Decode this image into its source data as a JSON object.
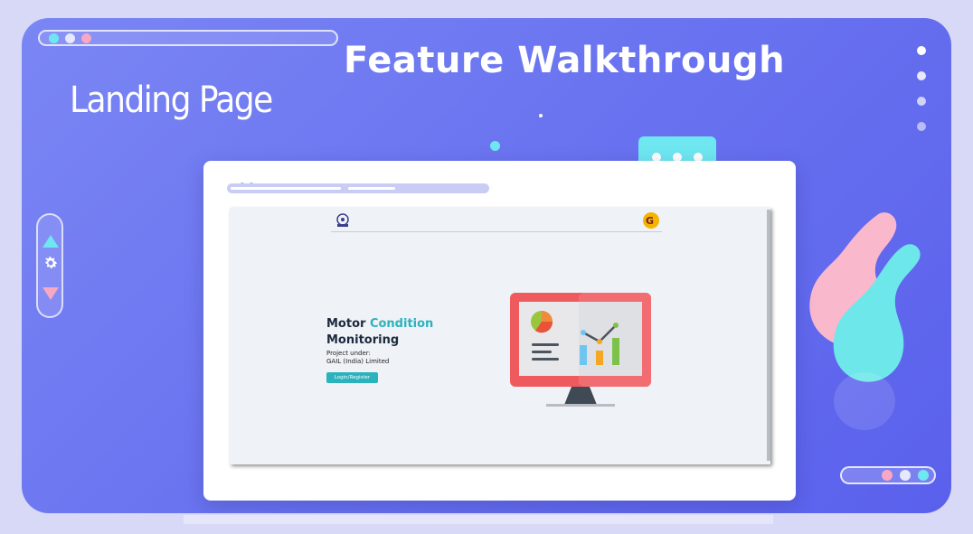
{
  "header": {
    "title": "Feature Walkthrough",
    "subtitle": "Landing Page"
  },
  "colors": {
    "frame": "#6a74f0",
    "accent_teal": "#2bb3bd",
    "cyan": "#6ee7f0",
    "pink": "#f8a7c4"
  },
  "side_toolbar": {
    "icons": [
      "triangle-up-icon",
      "gear-icon",
      "triangle-down-icon"
    ]
  },
  "app": {
    "title_part1": "Motor ",
    "title_part2": "Condition",
    "title_line2": "Monitoring",
    "subtitle_line1": "Project under:",
    "subtitle_line2": "GAIL (India) Limited",
    "login_button": "Login/Register"
  }
}
